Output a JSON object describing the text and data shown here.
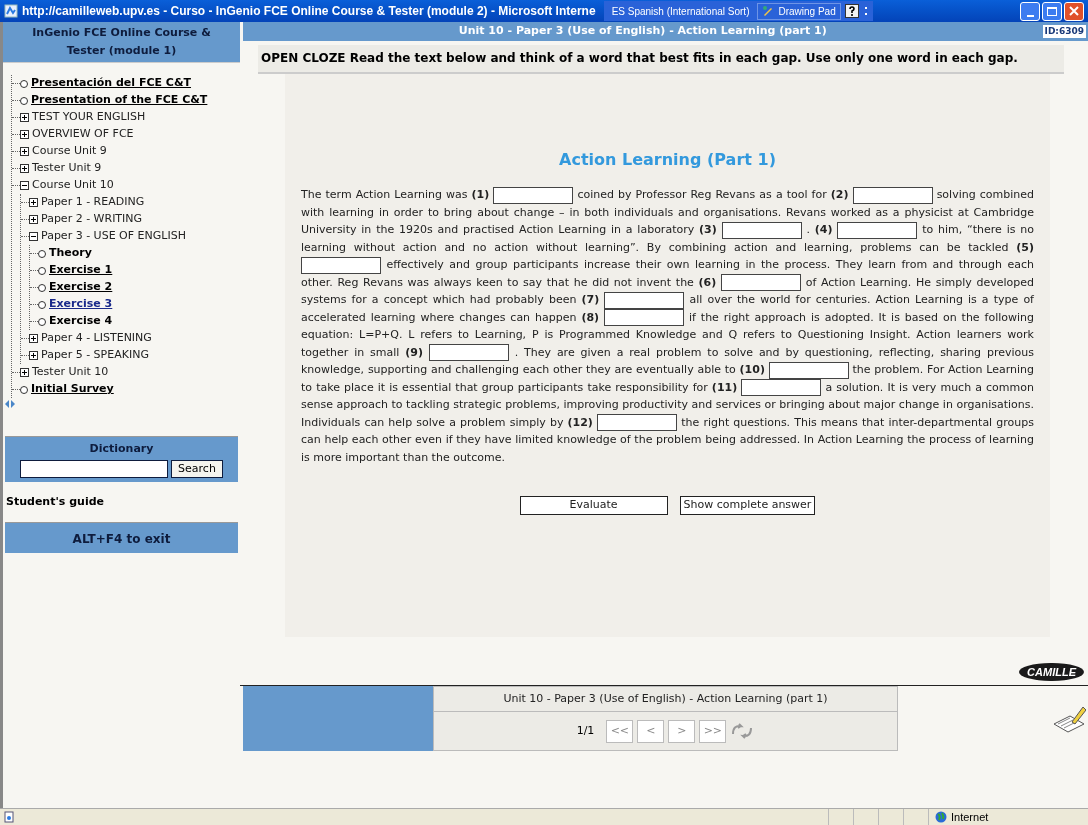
{
  "window": {
    "title": "http://camilleweb.upv.es - Curso - InGenio FCE Online Course & Tester (module 2) - Microsoft Interne",
    "language_bar": {
      "language": "ES Spanish (International Sort)",
      "tool": "Drawing Pad"
    }
  },
  "sidebar": {
    "title": "InGenio FCE Online Course & Tester (module 1)",
    "tree": [
      {
        "kind": "page",
        "label": "Presentación del FCE C&T",
        "link": true,
        "selected": false
      },
      {
        "kind": "page",
        "label": "Presentation of the FCE C&T",
        "link": true,
        "selected": false
      },
      {
        "kind": "folder",
        "label": "TEST YOUR ENGLISH",
        "expanded": false
      },
      {
        "kind": "folder",
        "label": "OVERVIEW OF FCE",
        "expanded": false
      },
      {
        "kind": "folder",
        "label": "Course Unit 9",
        "expanded": false
      },
      {
        "kind": "folder",
        "label": "Tester Unit 9",
        "expanded": false
      },
      {
        "kind": "folder",
        "label": "Course Unit 10",
        "expanded": true,
        "children": [
          {
            "kind": "folder",
            "label": "Paper 1 - READING",
            "expanded": false
          },
          {
            "kind": "folder",
            "label": "Paper 2 - WRITING",
            "expanded": false
          },
          {
            "kind": "folder",
            "label": "Paper 3 - USE OF ENGLISH",
            "expanded": true,
            "children": [
              {
                "kind": "page",
                "label": "Theory",
                "link": false,
                "selected": false
              },
              {
                "kind": "page",
                "label": "Exercise 1",
                "link": true,
                "selected": false
              },
              {
                "kind": "page",
                "label": "Exercise 2",
                "link": true,
                "selected": false
              },
              {
                "kind": "page",
                "label": "Exercise 3",
                "link": true,
                "selected": true
              },
              {
                "kind": "page",
                "label": "Exercise 4",
                "link": false,
                "selected": false
              }
            ]
          },
          {
            "kind": "folder",
            "label": "Paper 4 - LISTENING",
            "expanded": false
          },
          {
            "kind": "folder",
            "label": "Paper 5 - SPEAKING",
            "expanded": false
          }
        ]
      },
      {
        "kind": "folder",
        "label": "Tester Unit 10",
        "expanded": false
      },
      {
        "kind": "page",
        "label": "Initial Survey",
        "link": true,
        "selected": false
      }
    ],
    "dictionary": {
      "title": "Dictionary",
      "button": "Search"
    },
    "guide": "Student's guide",
    "exit": "ALT+F4 to exit"
  },
  "header": {
    "title": "Unit 10 - Paper 3 (Use of English) - Action Learning (part 1)",
    "id": "ID:6309"
  },
  "instructions": "OPEN CLOZE Read the text below and think of a word that best fits in each gap. Use only one word in each gap.",
  "exercise": {
    "title": "Action Learning (Part 1)",
    "passage": [
      {
        "kind": "text",
        "text": "The term Action Learning was"
      },
      {
        "kind": "gap",
        "number": "(1)"
      },
      {
        "kind": "text",
        "text": "coined by Professor Reg Revans as a tool for"
      },
      {
        "kind": "gap",
        "number": "(2)"
      },
      {
        "kind": "text",
        "text": "solving combined with learning in order to bring about change – in both individuals and organisations. Revans worked as a physicist at Cambridge University in the 1920s and practised Action Learning in a laboratory"
      },
      {
        "kind": "gap",
        "number": "(3)"
      },
      {
        "kind": "text",
        "text": ". "
      },
      {
        "kind": "gap",
        "number": "(4)"
      },
      {
        "kind": "text",
        "text": "to him, “there is no learning without action and no action without learning”. By combining action and learning, problems can be tackled"
      },
      {
        "kind": "gap",
        "number": "(5)"
      },
      {
        "kind": "text",
        "text": "effectively and group participants increase their own learning in the process. They learn from and through each other. Reg Revans was always keen to say that he did not invent the"
      },
      {
        "kind": "gap",
        "number": "(6)"
      },
      {
        "kind": "text",
        "text": "of Action Learning. He simply developed systems for a concept which had probably been"
      },
      {
        "kind": "gap",
        "number": "(7)"
      },
      {
        "kind": "text",
        "text": "all over the world for centuries. Action Learning is a type of accelerated learning where changes can happen"
      },
      {
        "kind": "gap",
        "number": "(8)"
      },
      {
        "kind": "text",
        "text": "if the right approach is adopted. It is based on the following equation: L=P+Q. L refers to Learning, P is Programmed Knowledge and Q refers to Questioning Insight. Action learners work together in small"
      },
      {
        "kind": "gap",
        "number": "(9)"
      },
      {
        "kind": "text",
        "text": ". They are given a real problem to solve and by questioning, reflecting, sharing previous knowledge, supporting and challenging each other they are eventually able to"
      },
      {
        "kind": "gap",
        "number": "(10)"
      },
      {
        "kind": "text",
        "text": "the problem. For Action Learning to take place it is essential that group participants take responsibility for"
      },
      {
        "kind": "gap",
        "number": "(11)"
      },
      {
        "kind": "text",
        "text": "a solution. It is very much a common sense approach to tackling strategic problems, improving productivity and services or bringing about major change in organisations. Individuals can help solve a problem simply by"
      },
      {
        "kind": "gap",
        "number": "(12)"
      },
      {
        "kind": "text",
        "text": "the right questions. This means that inter-departmental groups can help each other even if they have limited knowledge of the problem being addressed. In Action Learning the process of learning is more important than the outcome."
      }
    ],
    "buttons": [
      "Evaluate",
      "Show complete answer"
    ]
  },
  "logo": "CAMILLE",
  "footer": {
    "title": "Unit 10 - Paper 3 (Use of English) - Action Learning (part 1)",
    "page": "1/1",
    "nav": [
      "<<",
      "<",
      ">",
      ">>"
    ]
  },
  "status_bar": {
    "zone": "Internet"
  }
}
